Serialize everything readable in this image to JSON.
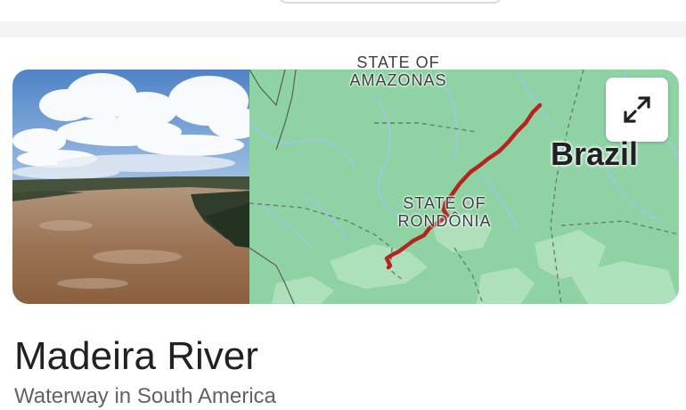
{
  "map": {
    "region_labels": [
      "STATE OF",
      "AMAZONAS"
    ],
    "region_labels_2": [
      "STATE OF",
      "RONDÔNIA"
    ],
    "country_label": "Brazil",
    "river_color": "#b3261e",
    "land_color": "#8fd3a4",
    "expand_icon": "expand-arrows-icon"
  },
  "entity": {
    "title": "Madeira River",
    "subtitle": "Waterway in South America"
  }
}
